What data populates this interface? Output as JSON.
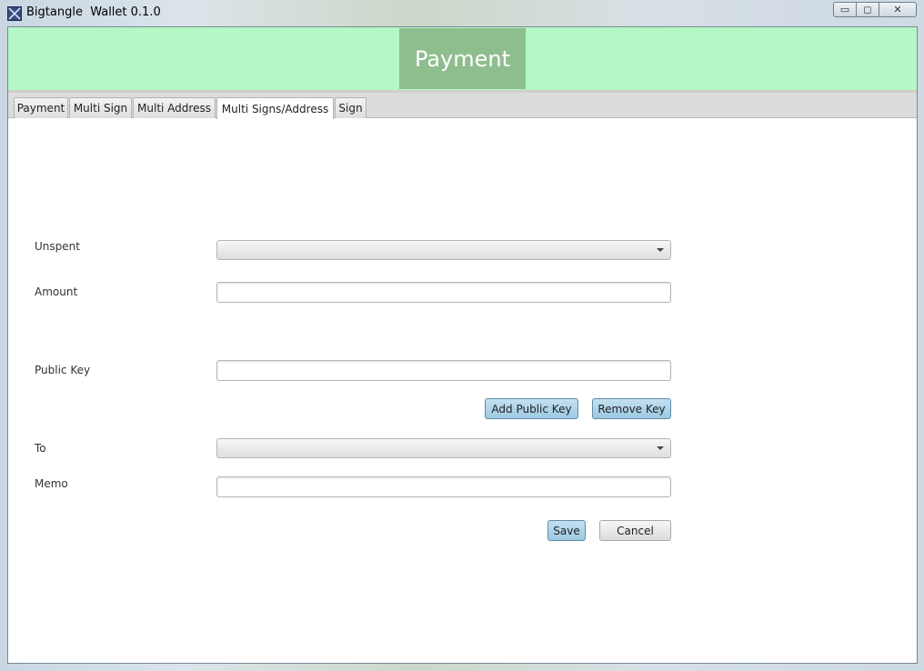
{
  "window": {
    "title": "Bigtangle  Wallet 0.1.0",
    "controls": {
      "minimize": "▭",
      "maximize": "◻",
      "close": "✕"
    }
  },
  "header": {
    "title": "Payment",
    "band_color": "#b4f8c6",
    "title_bg": "#8fbe8e"
  },
  "tabs": [
    {
      "label": "Payment"
    },
    {
      "label": "Multi Sign"
    },
    {
      "label": "Multi Address"
    },
    {
      "label": "Multi Signs/Address",
      "active": true
    },
    {
      "label": "Sign"
    }
  ],
  "form": {
    "unspent": {
      "label": "Unspent",
      "value": ""
    },
    "amount": {
      "label": "Amount",
      "value": ""
    },
    "public_key": {
      "label": "Public Key",
      "value": ""
    },
    "add_public_key": "Add Public Key",
    "remove_key": "Remove Key",
    "to": {
      "label": "To",
      "value": ""
    },
    "memo": {
      "label": "Memo",
      "value": ""
    },
    "save": "Save",
    "cancel": "Cancel"
  },
  "colors": {
    "accent_button": "#a9d2e8",
    "window_bg": "#ffffff"
  },
  "icons": {
    "app": "bigtangle-app-icon"
  }
}
